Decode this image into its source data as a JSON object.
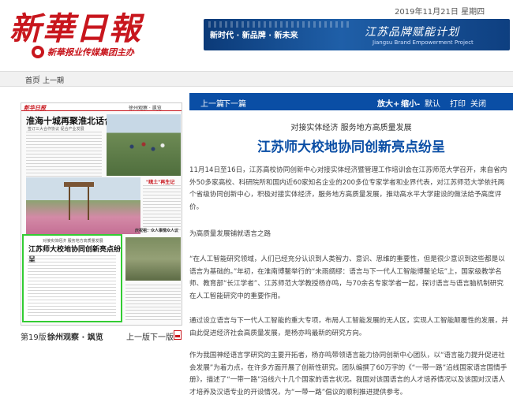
{
  "header": {
    "logo_text": "新華日報",
    "logo_sub": "新華报业传媒集团主办",
    "date": "2019年11月21日 星期四",
    "banner_left": "新时代 · 新品牌 · 新未来",
    "banner_right": "江苏品牌赋能计划",
    "banner_sub": "Jiangsu Brand Empowerment Project"
  },
  "nav": {
    "home": "首页",
    "separator": "|",
    "prev": "上一期"
  },
  "thumbnail": {
    "head_logo": "新华日报",
    "head_right": "徐州观察 · 飒览",
    "title1": "淮海十城再聚淮北话合作",
    "small1": "签订三大合作协议 促合产业发展",
    "mid_title": "\"疏土\"再生记",
    "caption2": "庆祝祖：众人事情众人议",
    "hl_small": "对接实体经济  服务地方高质量发展",
    "hl_title": "江苏师大校地协同创新亮点纷呈"
  },
  "page_nav": {
    "page_label": "第19版：",
    "page_name": "徐州观察 · 飒览",
    "prev": "上一版",
    "next": "下一版",
    "pdf_icon": "pdf-icon"
  },
  "article_toolbar": {
    "prev": "上一篇",
    "next": "下一篇",
    "zoom_in": "放大+",
    "zoom_out": "缩小-",
    "reset": "默认",
    "print": "打印",
    "close": "关闭"
  },
  "article": {
    "subtitle": "对接实体经济  服务地方高质量发展",
    "title": "江苏师大校地协同创新亮点纷呈",
    "p1": "11月14日至16日，江苏高校协同创新中心对接实体经济暨管理工作培训会在江苏师范大学召开，来自省内外50多家高校、科研院所和国内近60家知名企业的200多位专家学者和业界代表，对江苏师范大学依托两个省级协同创新中心，积极对接实体经济，服务地方高质量发展，推动高水平大学建设的做法给予高度评价。",
    "p2": "为高质量发展铺就语言之路",
    "p3": "“在人工智能研究领域，人们已经充分认识到人类智力、意识、思维的重要性，但是很少意识到这些都是以语言为基础的。”年初，在淮南博鳌举行的“未雨绸缪：语言与下一代人工智能博鳌论坛”上，国家级教学名师、教育部“长江学者”、江苏师范大学教授杨亦鸣，与70余名专家学者一起，探讨语言与语言脑机制研究在人工智能研究中的重要作用。",
    "p4": "通过设立语言与下一代人工智能的重大专项，布局人工智能发展的无人区，实现人工智能颠覆性的发展，并由此促进经济社会高质量发展，是杨亦鸣最新的研究方向。",
    "p5": "作为我国神经语言学研究的主要开拓者，杨亦鸣带领语言能力协同创新中心团队，以“语言能力提升促进社会发展”为着力点，在许多方面开展了创新性研究。团队编撰了60万字的《“一带一路”沿线国家语言国情手册》，描述了“一带一路”沿线六十几个国家的语言状况。我国对该国语言的人才培养情况以及该国对汉语人才培养及汉语专业的开设情况，为“一带一路”倡议的顺利推进提供参考。"
  },
  "colors": {
    "brand_red": "#c8161d",
    "toolbar_blue": "#0a4ea5",
    "highlight_green": "#33cc33"
  }
}
